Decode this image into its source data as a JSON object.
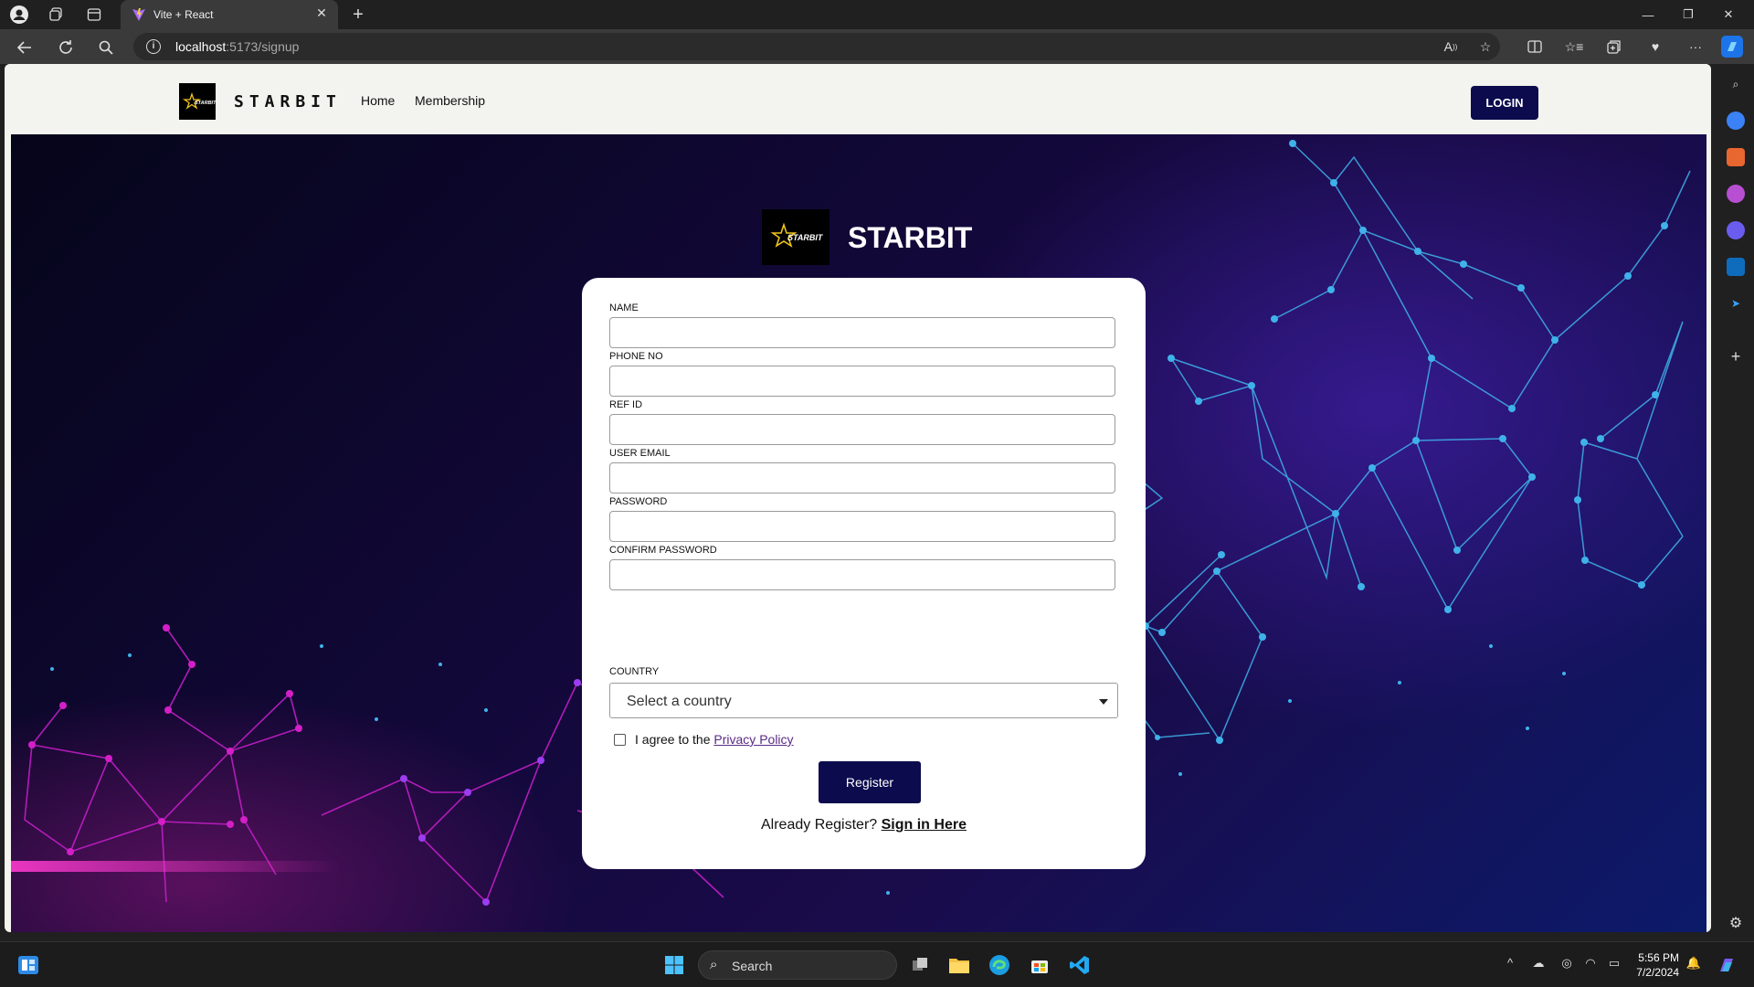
{
  "browser": {
    "tab_title": "Vite + React",
    "tab_close": "✕",
    "new_tab": "+",
    "url_host": "localhost",
    "url_path": ":5173/signup"
  },
  "site": {
    "brand": "STARBIT",
    "logo_text": "STARBIT",
    "nav": [
      "Home",
      "Membership"
    ],
    "login_label": "LOGIN"
  },
  "form": {
    "brand": "STARBIT",
    "fields": [
      {
        "label": "NAME",
        "value": ""
      },
      {
        "label": "PHONE NO",
        "value": ""
      },
      {
        "label": "REF ID",
        "value": ""
      },
      {
        "label": "USER EMAIL",
        "value": ""
      },
      {
        "label": "PASSWORD",
        "value": ""
      },
      {
        "label": "CONFIRM PASSWORD",
        "value": ""
      }
    ],
    "country_label": "COUNTRY",
    "country_placeholder": "Select a country",
    "agree_prefix": "I agree to the ",
    "privacy_link": "Privacy Policy",
    "agree_checked": false,
    "register_label": "Register",
    "already_text": "Already Register? ",
    "signin_link": "Sign in Here"
  },
  "taskbar": {
    "search_placeholder": "Search",
    "time": "5:56 PM",
    "date": "7/2/2024"
  },
  "colors": {
    "primary_button": "#0b0b4d",
    "link": "#5b2a86",
    "network_blue": "#3fb2ea",
    "network_pink": "#d41fc8"
  }
}
